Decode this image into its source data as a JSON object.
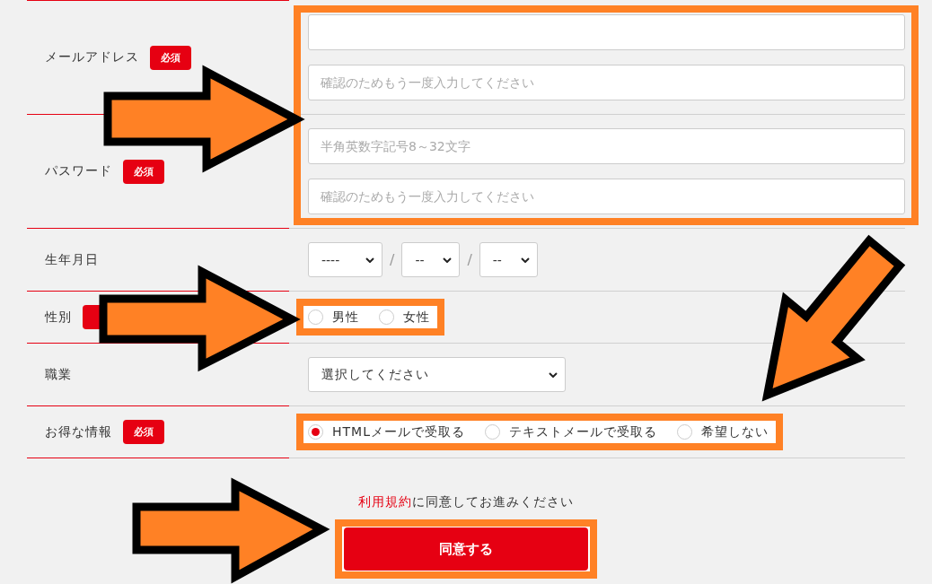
{
  "credentials": {
    "highlighted": true,
    "rows": [
      {
        "label": "メールアドレス",
        "badge": "必須",
        "blank_field": true,
        "fields": [
          {
            "placeholder": "確認のためもう一度入力してください"
          }
        ]
      },
      {
        "label": "パスワード",
        "badge": "必須",
        "fields": [
          {
            "placeholder": "半角英数字記号8～32文字"
          },
          {
            "placeholder": "確認のためもう一度入力してください"
          }
        ]
      }
    ]
  },
  "rows": [
    {
      "kind": "date",
      "label": "生年月日",
      "selects": [
        {
          "value": "----"
        },
        {
          "value": "--"
        },
        {
          "value": "--"
        }
      ],
      "separators": [
        "/",
        "/"
      ]
    },
    {
      "kind": "radio",
      "label": "性別",
      "required": true,
      "highlighted": true,
      "options": [
        {
          "label": "男性",
          "selected": false
        },
        {
          "label": "女性",
          "selected": false
        }
      ]
    },
    {
      "kind": "select",
      "label": "職業",
      "selects": [
        {
          "value": "選択してください"
        }
      ]
    },
    {
      "kind": "radio",
      "label": "お得な情報",
      "badge": "必須",
      "highlighted": true,
      "options": [
        {
          "label": "HTMLメールで受取る",
          "selected": true
        },
        {
          "label": "テキストメールで受取る",
          "selected": false
        },
        {
          "label": "希望しない",
          "selected": false
        }
      ]
    }
  ],
  "terms": {
    "link": "利用規約",
    "text": "に同意してお進みください"
  },
  "submit": {
    "label": "同意する",
    "highlighted": true
  }
}
